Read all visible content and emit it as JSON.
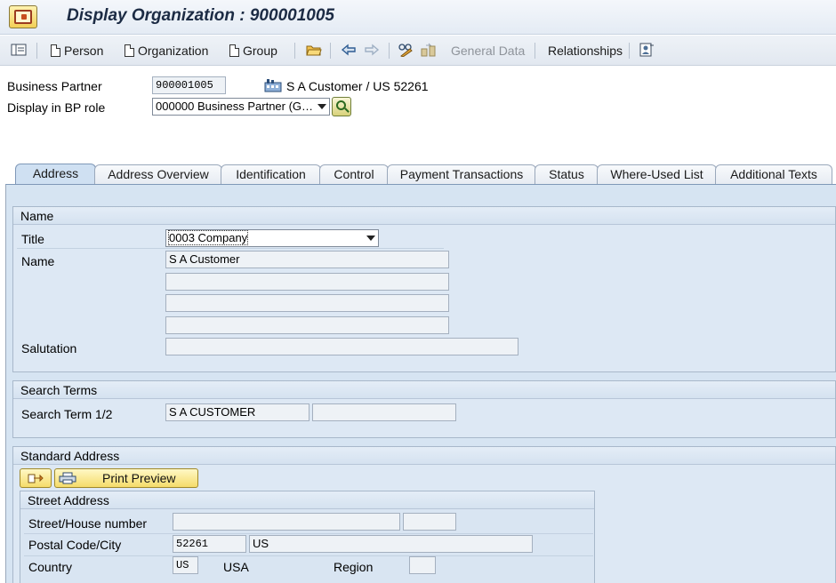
{
  "window": {
    "title": "Display Organization : 900001005"
  },
  "toolbar": {
    "person_label": "Person",
    "organization_label": "Organization",
    "group_label": "Group",
    "general_data_label": "General Data",
    "relationships_label": "Relationships"
  },
  "header": {
    "bp_label": "Business Partner",
    "bp_value": "900001005",
    "bp_description": "S A Customer / US 52261",
    "role_label": "Display in BP role",
    "role_value": "000000 Business Partner (G…"
  },
  "tabs": [
    {
      "label": "Address",
      "active": true
    },
    {
      "label": "Address Overview",
      "active": false
    },
    {
      "label": "Identification",
      "active": false
    },
    {
      "label": "Control",
      "active": false
    },
    {
      "label": "Payment Transactions",
      "active": false
    },
    {
      "label": "Status",
      "active": false
    },
    {
      "label": "Where-Used List",
      "active": false
    },
    {
      "label": "Additional Texts",
      "active": false
    }
  ],
  "name_group": {
    "title": "Name",
    "title_label": "Title",
    "title_value": "0003 Company",
    "name_label": "Name",
    "name1": "S A Customer",
    "name2": "",
    "name3": "",
    "name4": "",
    "salutation_label": "Salutation",
    "salutation_value": ""
  },
  "search_group": {
    "title": "Search Terms",
    "label": "Search Term 1/2",
    "term1": "S A CUSTOMER",
    "term2": ""
  },
  "address_group": {
    "title": "Standard Address",
    "print_preview_label": "Print Preview",
    "street_group_title": "Street Address",
    "street_label": "Street/House number",
    "street_value": "",
    "house_number_value": "",
    "postal_city_label": "Postal Code/City",
    "postal_code": "52261",
    "city": "US",
    "country_label": "Country",
    "country_code": "US",
    "country_name": "USA",
    "region_label": "Region",
    "region_value": ""
  },
  "colors": {
    "panel_background": "#d6e4f2",
    "active_tab": "#cfe0f2",
    "button_yellow": "#f5dc6a",
    "title_text": "#1c2b44"
  },
  "icons": {
    "app": "sap-display-organization-icon",
    "layout": "screen-layout-icon",
    "open": "folder-open-icon",
    "back": "arrow-left-icon",
    "forward": "arrow-right-icon",
    "edit": "pencil-glasses-icon",
    "display_change": "display-change-icon",
    "other": "other-partner-icon",
    "building": "building-icon",
    "lookup": "magnifier-icon",
    "transfer": "transfer-arrow-icon",
    "printer": "printer-icon"
  }
}
